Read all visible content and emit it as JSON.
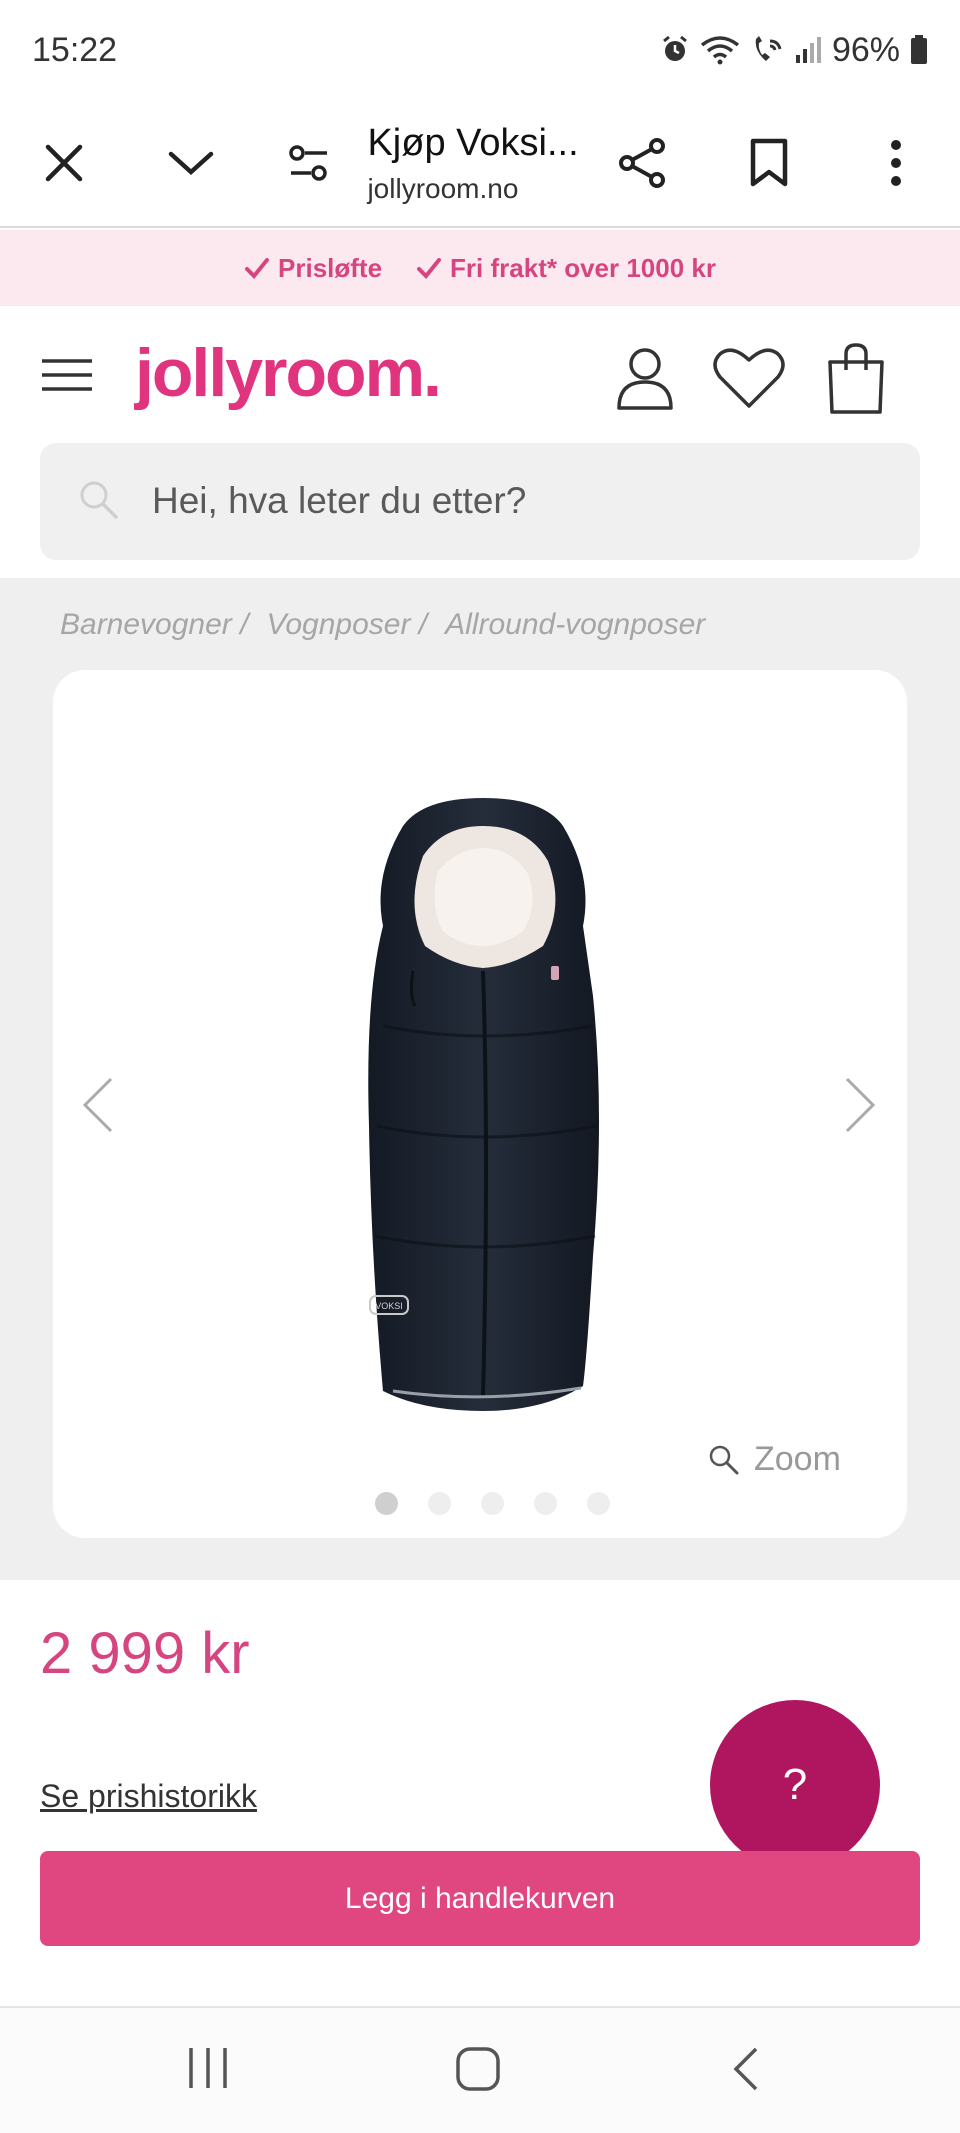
{
  "status_bar": {
    "time": "15:22",
    "battery": "96%"
  },
  "browser": {
    "title": "Kjøp Voksi...",
    "domain": "jollyroom.no"
  },
  "promo": {
    "items": [
      "Prisløfte",
      "Fri frakt* over 1000 kr"
    ]
  },
  "site": {
    "logo": "jollyroom."
  },
  "search": {
    "placeholder": "Hei, hva leter du etter?"
  },
  "breadcrumb": [
    "Barnevogner /",
    "Vognposer /",
    "Allround-vognposer"
  ],
  "gallery": {
    "zoom_label": "Zoom",
    "image_count": 5,
    "active_index": 0
  },
  "product": {
    "price": "2 999 kr",
    "price_history_link": "Se prishistorikk",
    "add_to_cart": "Legg i handlekurven",
    "help_button": "?",
    "image_brand_label": "VOKSI"
  },
  "colors": {
    "brand_pink": "#e0347e",
    "help_bubble": "#b0155f",
    "promo_bg": "#fce9ef"
  }
}
